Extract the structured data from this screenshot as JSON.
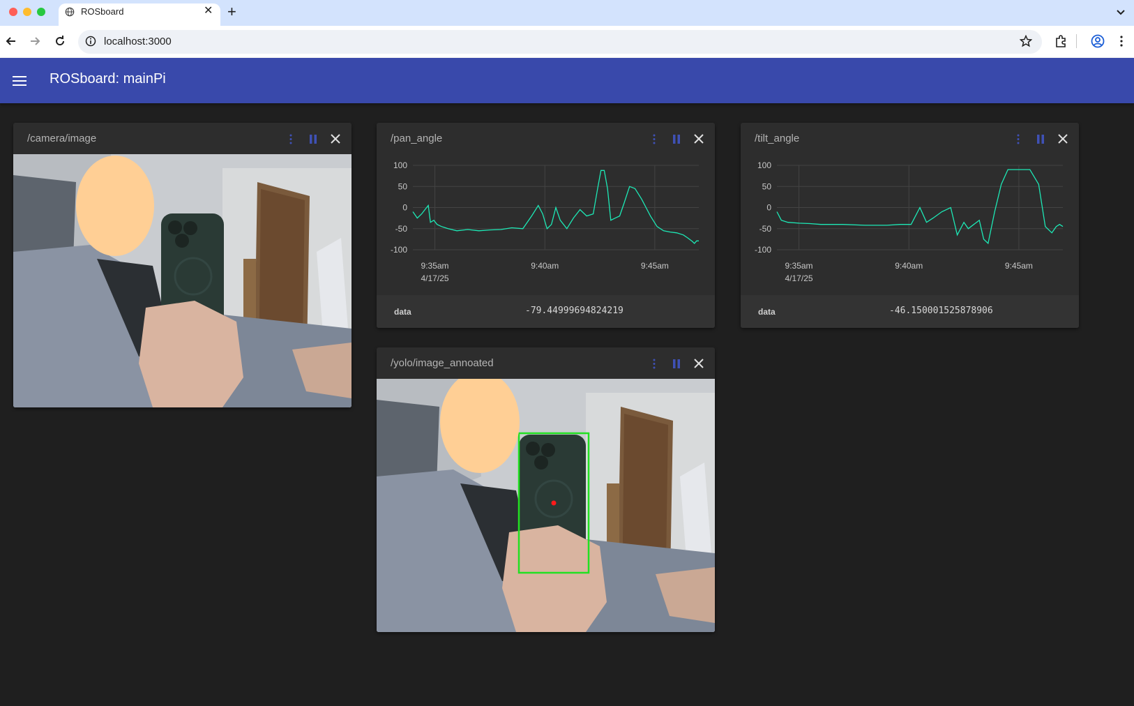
{
  "browser": {
    "tab_title": "ROSboard",
    "url": "localhost:3000"
  },
  "app": {
    "title": "ROSboard: mainPi",
    "accent_color": "#3949ab"
  },
  "cards": {
    "camera": {
      "topic": "/camera/image"
    },
    "pan": {
      "topic": "/pan_angle",
      "data_key": "data",
      "data_value": "-79.44999694824219"
    },
    "tilt": {
      "topic": "/tilt_angle",
      "data_key": "data",
      "data_value": "-46.150001525878906"
    },
    "yolo": {
      "topic": "/yolo/image_annoated"
    }
  },
  "chart_data": [
    {
      "type": "line",
      "y_ticks": [
        "100",
        "50",
        "0",
        "-50",
        "-100"
      ],
      "x_ticks": [
        "9:35am",
        "9:40am",
        "9:45am"
      ],
      "x_tick_sublabel": "4/17/25",
      "ylim": [
        -100,
        100
      ],
      "xlim": [
        0,
        13
      ],
      "x_tick_positions": [
        1,
        6,
        11
      ],
      "grid": true,
      "line_color": "#1de9b6",
      "series": [
        {
          "x": [
            0,
            0.2,
            0.4,
            0.55,
            0.7,
            0.8,
            0.95,
            1.1,
            1.3,
            1.6,
            2.0,
            2.5,
            3.0,
            3.5,
            4.0,
            4.5,
            5.0,
            5.4,
            5.7,
            5.9,
            6.1,
            6.3,
            6.5,
            6.7,
            7.0,
            7.3,
            7.6,
            7.9,
            8.2,
            8.4,
            8.55,
            8.7,
            8.85,
            9.0,
            9.2,
            9.4,
            9.6,
            9.85,
            10.1,
            10.4,
            10.6,
            10.8,
            11.1,
            11.4,
            11.7,
            12.0,
            12.3,
            12.5,
            12.7,
            12.8,
            12.9,
            13.0
          ],
          "y": [
            -10,
            -25,
            -15,
            -5,
            5,
            -35,
            -30,
            -40,
            -45,
            -50,
            -55,
            -52,
            -55,
            -53,
            -52,
            -48,
            -50,
            -20,
            5,
            -15,
            -50,
            -40,
            0,
            -30,
            -50,
            -25,
            -5,
            -20,
            -15,
            45,
            88,
            88,
            45,
            -30,
            -25,
            -20,
            10,
            50,
            45,
            20,
            0,
            -20,
            -45,
            -55,
            -58,
            -60,
            -65,
            -72,
            -80,
            -85,
            -79,
            -79
          ]
        }
      ]
    },
    {
      "type": "line",
      "y_ticks": [
        "100",
        "50",
        "0",
        "-50",
        "-100"
      ],
      "x_ticks": [
        "9:35am",
        "9:40am",
        "9:45am"
      ],
      "x_tick_sublabel": "4/17/25",
      "ylim": [
        -100,
        100
      ],
      "xlim": [
        0,
        13
      ],
      "x_tick_positions": [
        1,
        6,
        11
      ],
      "grid": true,
      "line_color": "#1de9b6",
      "series": [
        {
          "x": [
            0,
            0.2,
            0.5,
            1.0,
            1.5,
            2.0,
            3.0,
            4.0,
            5.0,
            5.6,
            6.1,
            6.5,
            6.8,
            7.1,
            7.5,
            7.9,
            8.2,
            8.5,
            8.7,
            8.95,
            9.2,
            9.4,
            9.6,
            9.9,
            10.2,
            10.5,
            10.7,
            10.9,
            11.2,
            11.5,
            11.9,
            12.2,
            12.5,
            12.7,
            12.85,
            13.0
          ],
          "y": [
            -10,
            -30,
            -35,
            -37,
            -38,
            -40,
            -40,
            -42,
            -42,
            -40,
            -40,
            0,
            -35,
            -25,
            -10,
            0,
            -65,
            -35,
            -50,
            -40,
            -30,
            -75,
            -85,
            -10,
            55,
            90,
            90,
            90,
            90,
            90,
            55,
            -45,
            -60,
            -45,
            -40,
            -45
          ]
        }
      ]
    }
  ]
}
